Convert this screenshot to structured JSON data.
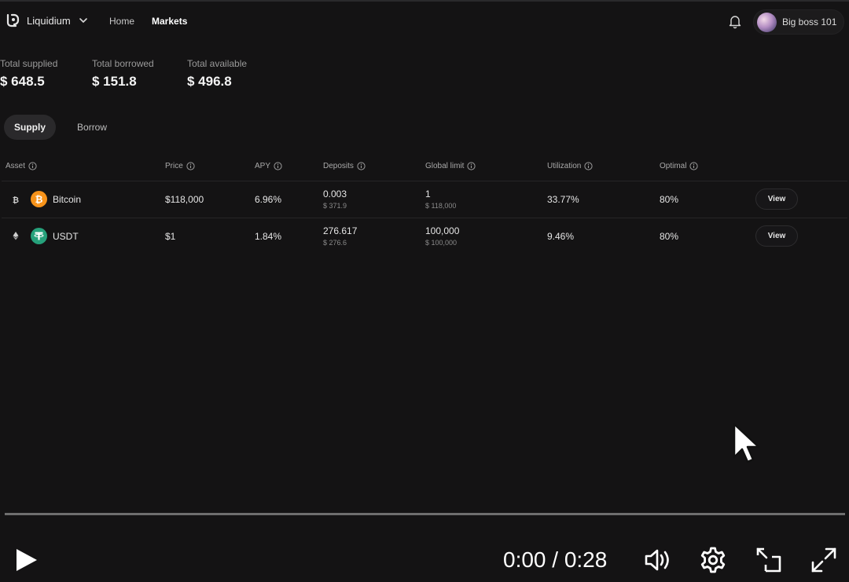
{
  "header": {
    "brand": "Liquidium",
    "nav": [
      {
        "label": "Home",
        "active": false
      },
      {
        "label": "Markets",
        "active": true
      }
    ],
    "user_name": "Big boss 101"
  },
  "stats": [
    {
      "label": "Total supplied",
      "value": "$ 648.5"
    },
    {
      "label": "Total borrowed",
      "value": "$ 151.8"
    },
    {
      "label": "Total available",
      "value": "$ 496.8"
    }
  ],
  "tabs": [
    {
      "label": "Supply",
      "active": true
    },
    {
      "label": "Borrow",
      "active": false
    }
  ],
  "table": {
    "headers": [
      "Asset",
      "Price",
      "APY",
      "Deposits",
      "Global limit",
      "Utilization",
      "Optimal"
    ],
    "rows": [
      {
        "chain_icon": "bitcoin-chain-icon",
        "coin_icon": "bitcoin-coin-icon",
        "asset": "Bitcoin",
        "price": "$118,000",
        "apy": "6.96%",
        "deposits": "0.003",
        "deposits_usd": "$ 371.9",
        "global_limit": "1",
        "global_limit_usd": "$ 118,000",
        "utilization": "33.77%",
        "optimal": "80%",
        "action": "View"
      },
      {
        "chain_icon": "ethereum-chain-icon",
        "coin_icon": "tether-coin-icon",
        "asset": "USDT",
        "price": "$1",
        "apy": "1.84%",
        "deposits": "276.617",
        "deposits_usd": "$ 276.6",
        "global_limit": "100,000",
        "global_limit_usd": "$ 100,000",
        "utilization": "9.46%",
        "optimal": "80%",
        "action": "View"
      }
    ]
  },
  "video": {
    "time": "0:00 / 0:28",
    "progress": 0.0
  },
  "colors": {
    "background": "#141314",
    "bitcoin": "#f7931a",
    "tether": "#26a17b"
  }
}
